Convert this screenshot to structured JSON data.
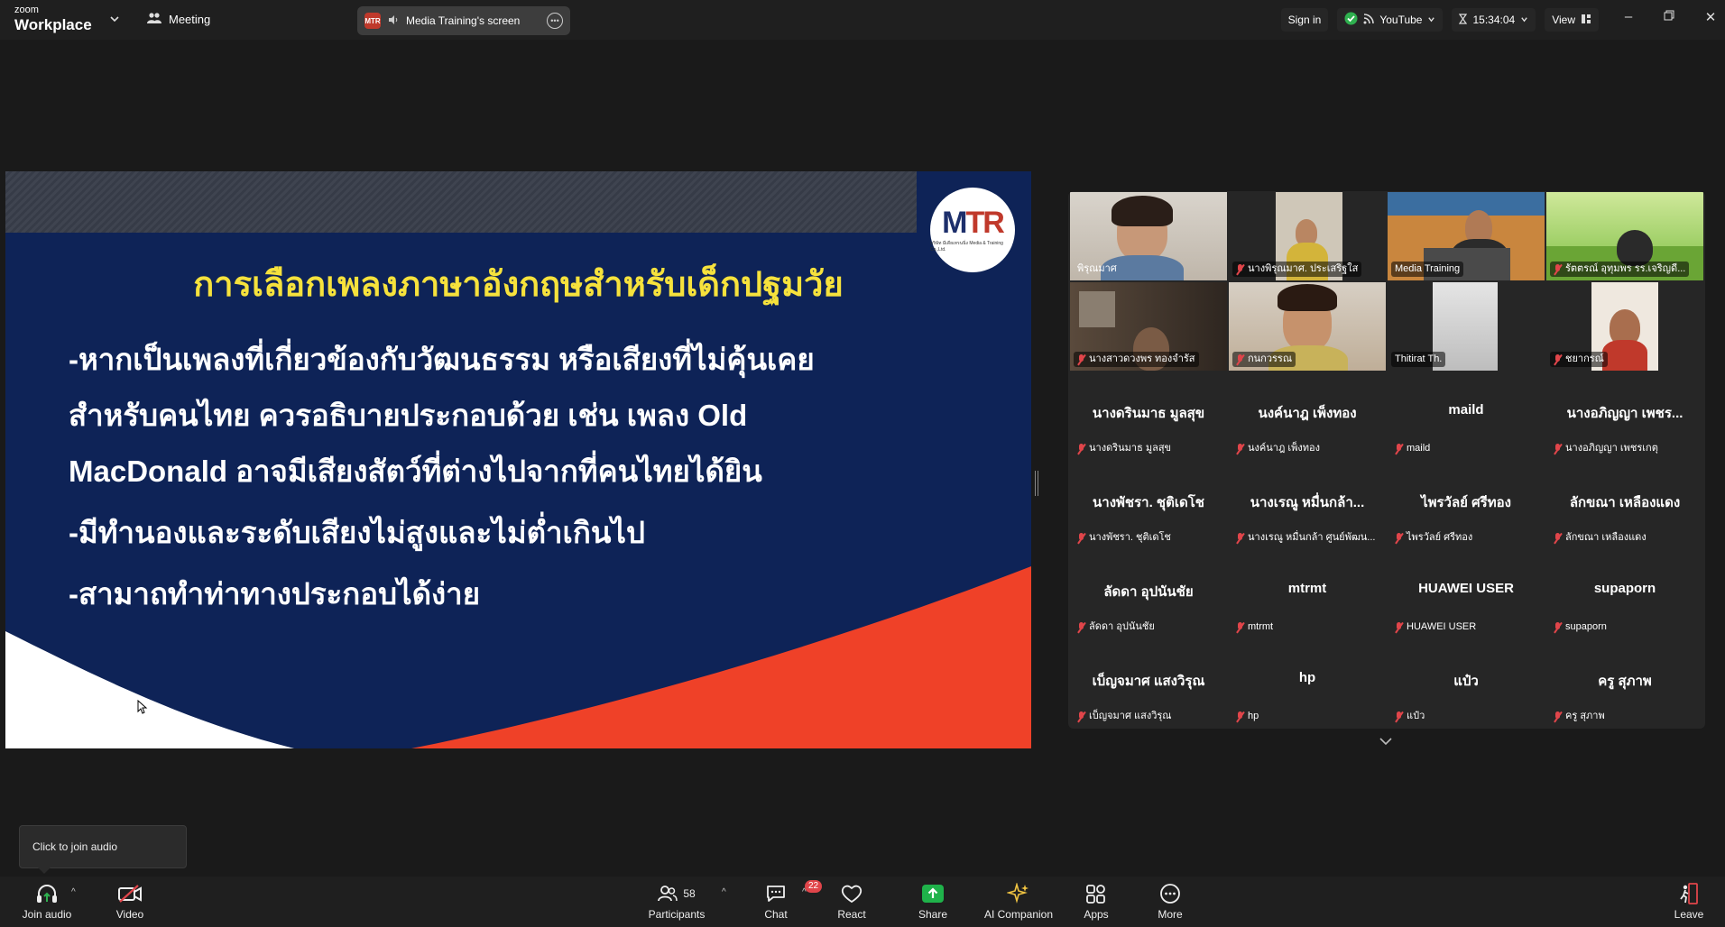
{
  "app": {
    "brand_line1": "zoom",
    "brand_line2": "Workplace",
    "meeting_label": "Meeting",
    "share_badge": "MTR",
    "share_label": "Media Training's screen"
  },
  "topbar": {
    "sign_in": "Sign in",
    "stream_label": "YouTube",
    "timer": "15:34:04",
    "view_label": "View"
  },
  "slide": {
    "logo": "MTR",
    "logo_caption": "บริษัท มีเดียเทรนนิ่ง Media & Training Co.,Ltd.",
    "title": "การเลือกเพลงภาษาอังกฤษสำหรับเด็กปฐมวัย",
    "lines": [
      "-หากเป็นเพลงที่เกี่ยวข้องกับวัฒนธรรม หรือเสียงที่ไม่คุ้นเคย",
      "สำหรับคนไทย ควรอธิบายประกอบด้วย เช่น เพลง Old",
      "MacDonald อาจมีเสียงสัตว์ที่ต่างไปจากที่คนไทยได้ยิน",
      "-มีทำนองและระดับเสียงไม่สูงและไม่ต่ำเกินไป",
      "-สามาถทำท่าทางประกอบได้ง่าย"
    ]
  },
  "participants": {
    "video_tiles": [
      {
        "label": "พิรุณมาศ",
        "muted": false
      },
      {
        "label": "นางพิรุณมาศ. ประเสริฐใส",
        "muted": true
      },
      {
        "label": "Media Training",
        "muted": false
      },
      {
        "label": "รัตตรณ์ อุทุมพร รร.เจริญดี...",
        "muted": true
      },
      {
        "label": "นางสาวดวงพร ทองจำรัส",
        "muted": true
      },
      {
        "label": "กนกวรรณ",
        "muted": true
      },
      {
        "label": "Thitirat Th.",
        "muted": false
      },
      {
        "label": "ชยากรณ์",
        "muted": true
      }
    ],
    "name_tiles": [
      {
        "name": "นางดรินมาธ มูลสุข",
        "label": "นางดรินมาธ มูลสุข"
      },
      {
        "name": "นงค์นาฎ เพ็งทอง",
        "label": "นงค์นาฎ เพ็งทอง"
      },
      {
        "name": "maild",
        "label": "maild"
      },
      {
        "name": "นางอภิญญา เพชร...",
        "label": "นางอภิญญา เพชรเกตุ"
      },
      {
        "name": "นางพัชรา. ชุติเดโช",
        "label": "นางพัชรา. ชุติเดโช"
      },
      {
        "name": "นางเรณู หมื่นกล้า...",
        "label": "นางเรณู หมื่นกล้า ศูนย์พัฒน..."
      },
      {
        "name": "ไพรวัลย์ ศรีทอง",
        "label": "ไพรวัลย์ ศรีทอง"
      },
      {
        "name": "ลักขณา เหลืองแดง",
        "label": "ลักขณา เหลืองแดง"
      },
      {
        "name": "ลัดดา อุปนันชัย",
        "label": "ลัดดา อุปนันชัย"
      },
      {
        "name": "mtrmt",
        "label": "mtrmt"
      },
      {
        "name": "HUAWEI USER",
        "label": "HUAWEI USER"
      },
      {
        "name": "supaporn",
        "label": "supaporn"
      },
      {
        "name": "เบ็ญจมาศ แสงวิรุณ",
        "label": "เบ็ญจมาศ แสงวิรุณ"
      },
      {
        "name": "hp",
        "label": "hp"
      },
      {
        "name": "แป๋ว",
        "label": "แป๋ว"
      },
      {
        "name": "ครู สุภาพ",
        "label": "ครู สุภาพ"
      }
    ]
  },
  "tooltip": "Click to join audio",
  "toolbar": {
    "join_audio": "Join audio",
    "video": "Video",
    "participants": "Participants",
    "participant_count": "58",
    "chat": "Chat",
    "chat_badge": "22",
    "react": "React",
    "share": "Share",
    "ai_companion": "AI Companion",
    "apps": "Apps",
    "more": "More",
    "leave": "Leave"
  },
  "colors": {
    "active_speaker": "#2fd26a",
    "share_green": "#1fb24a",
    "muted_red": "#e0454a",
    "slide_bg": "#0e2357",
    "slide_title": "#f6e23c",
    "slide_red": "#ef4128"
  }
}
